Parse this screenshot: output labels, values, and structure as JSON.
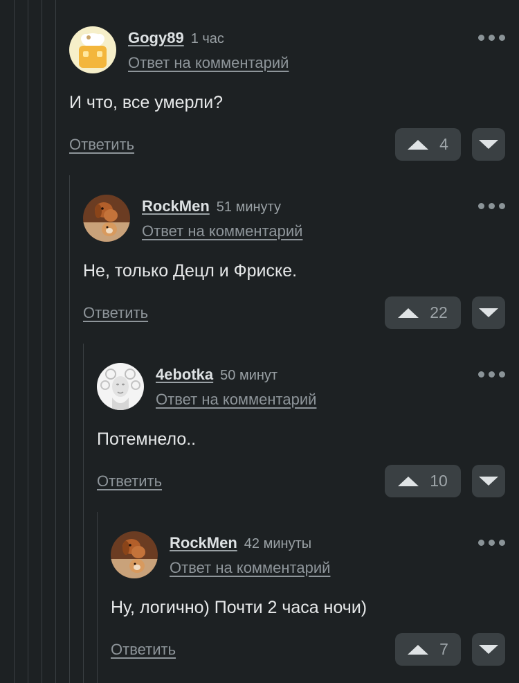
{
  "comments": [
    {
      "username": "Gogy89",
      "time": "1 час",
      "reply_ref": "Ответ на комментарий",
      "text": "И что, все умерли?",
      "reply_label": "Ответить",
      "votes": "4",
      "avatar_icon": "chef-hat-avatar"
    },
    {
      "username": "RockMen",
      "time": "51 минуту",
      "reply_ref": "Ответ на комментарий",
      "text": "Не, только Децл и Фриске.",
      "reply_label": "Ответить",
      "votes": "22",
      "avatar_icon": "dogs-photo-avatar"
    },
    {
      "username": "4ebotka",
      "time": "50 минут",
      "reply_ref": "Ответ на комментарий",
      "text": "Потемнело..",
      "reply_label": "Ответить",
      "votes": "10",
      "avatar_icon": "medusa-statue-avatar"
    },
    {
      "username": "RockMen",
      "time": "42 минуты",
      "reply_ref": "Ответ на комментарий",
      "text": "Ну, логично) Почти 2 часа ночи)",
      "reply_label": "Ответить",
      "votes": "7",
      "avatar_icon": "dogs-photo-avatar"
    }
  ],
  "colors": {
    "background": "#1d2123",
    "button_bg": "#3a4043",
    "muted_text": "#8e959a"
  }
}
